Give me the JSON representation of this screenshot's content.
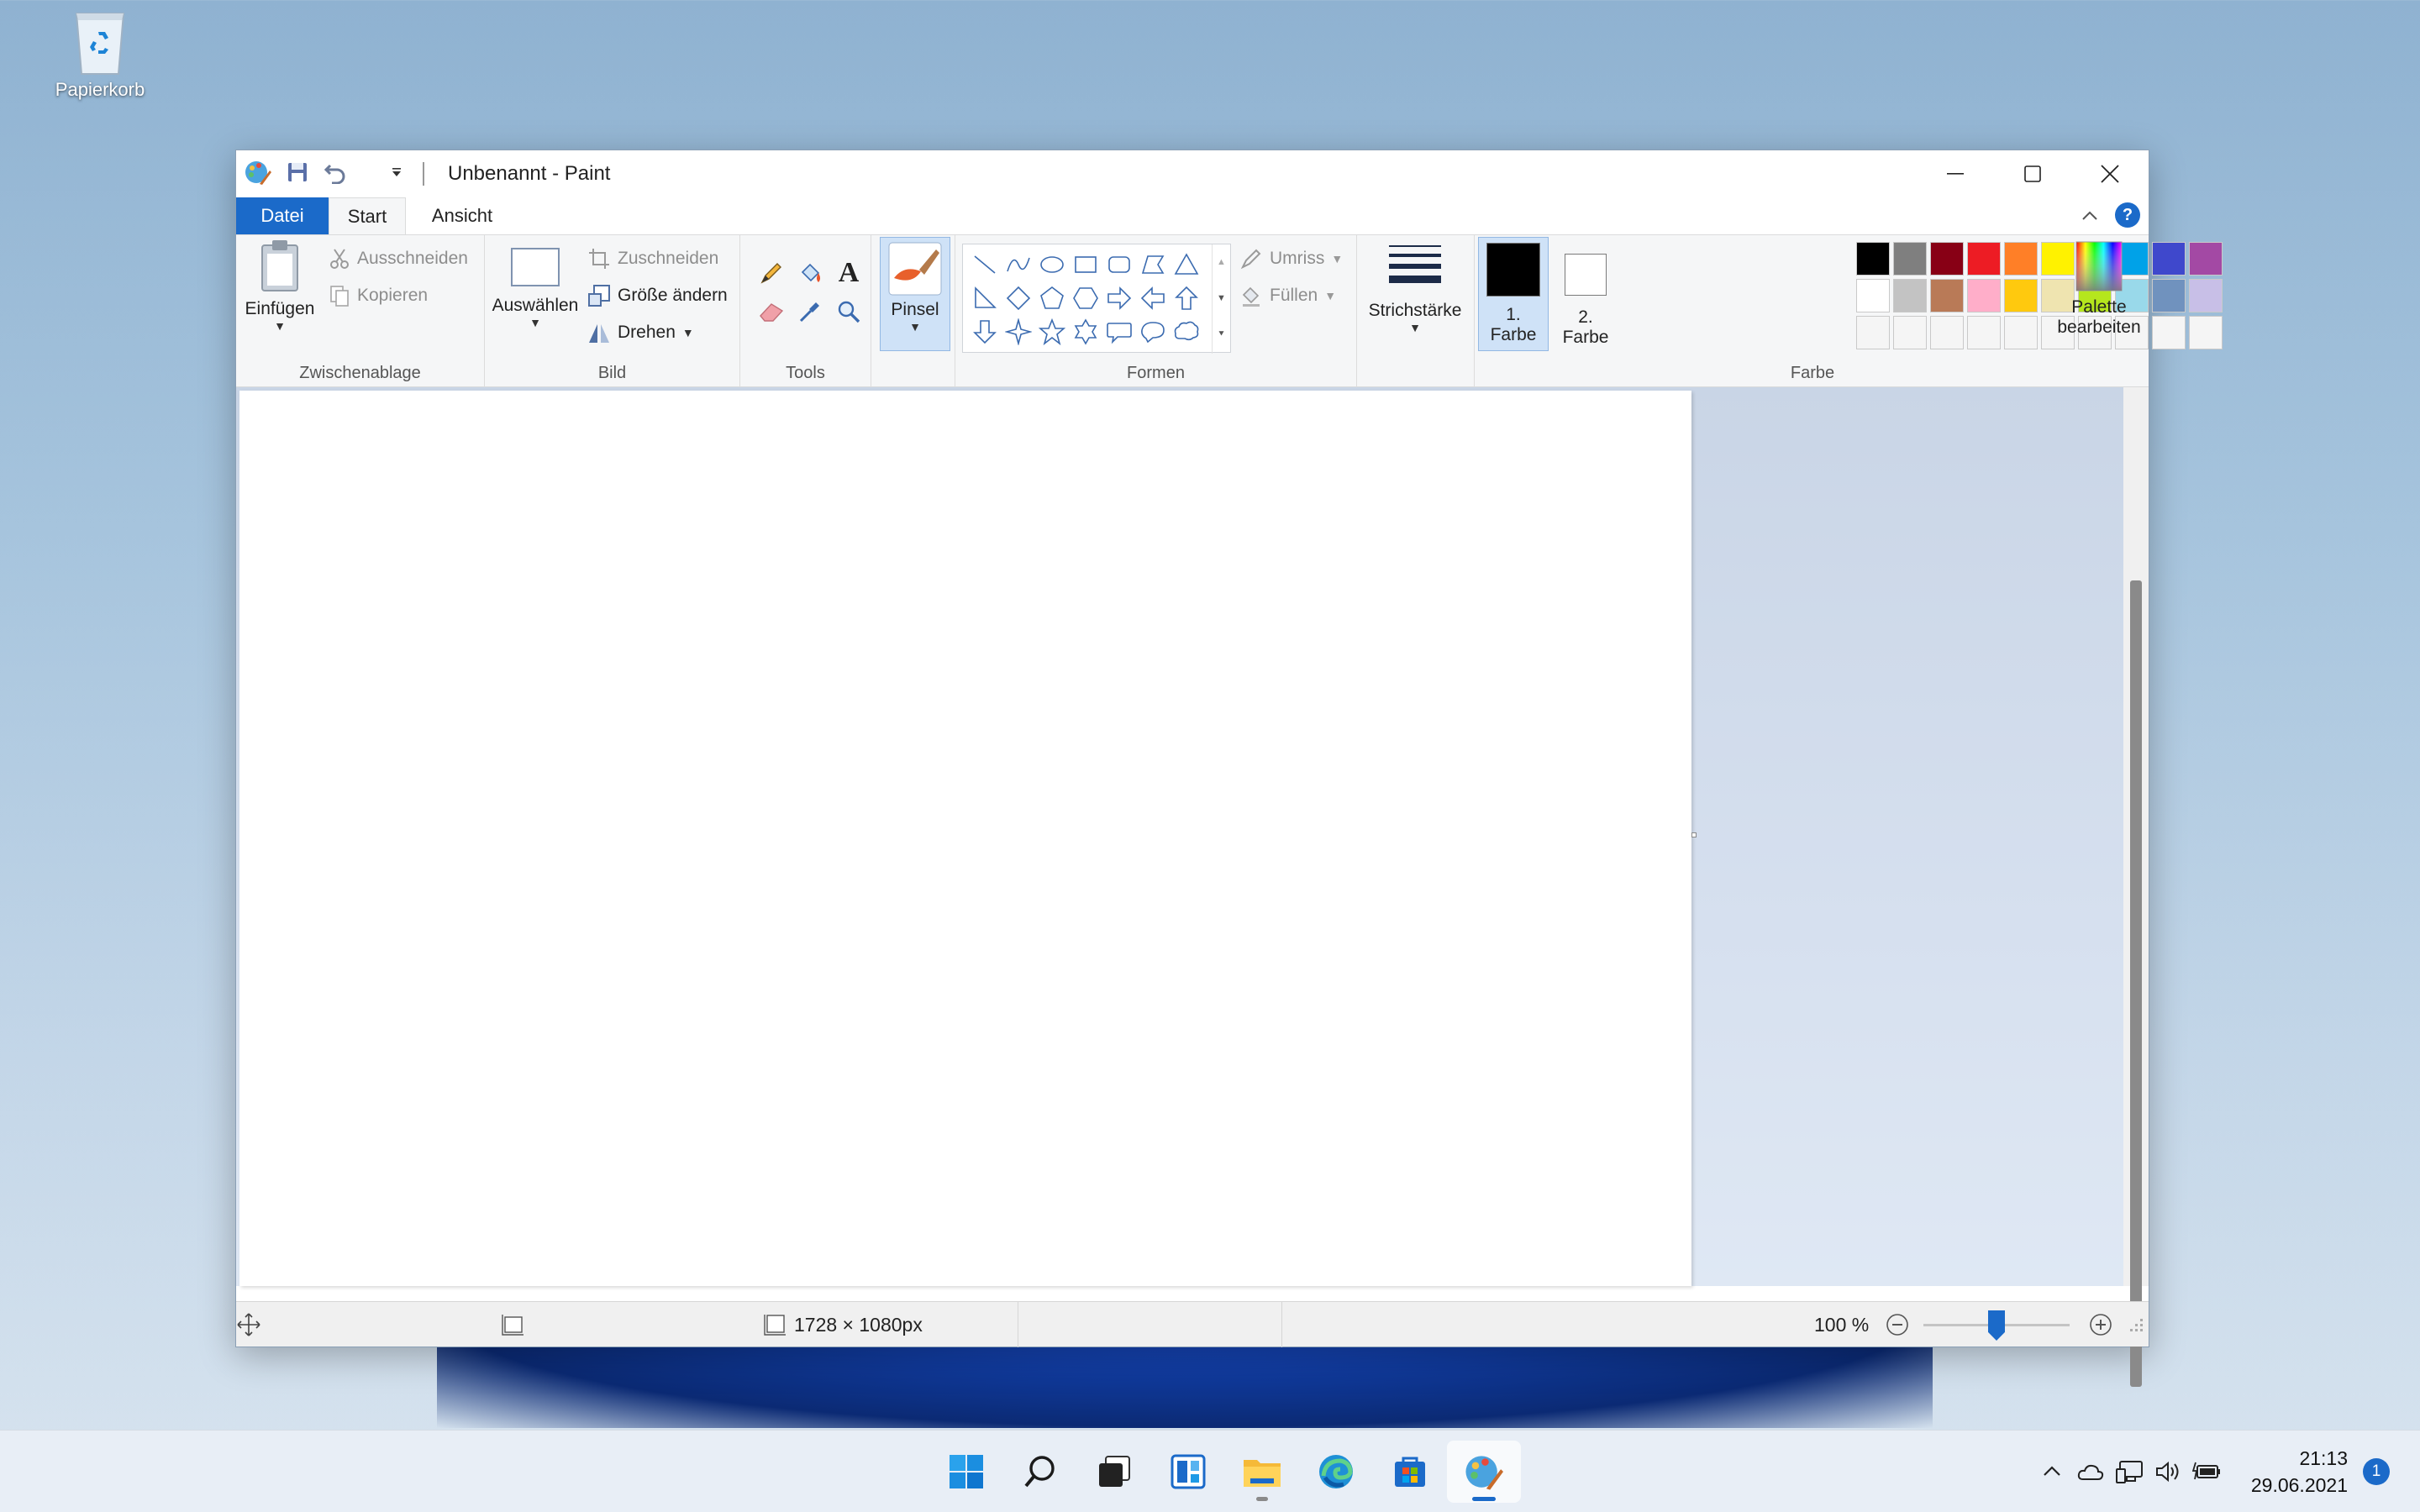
{
  "desktop": {
    "recycle_bin_label": "Papierkorb"
  },
  "window": {
    "title": "Unbenannt - Paint",
    "controls": {
      "minimize": "minimize",
      "maximize": "maximize",
      "close": "close"
    }
  },
  "tabs": {
    "file": "Datei",
    "home": "Start",
    "view": "Ansicht",
    "help": "?"
  },
  "ribbon": {
    "clipboard": {
      "group_label": "Zwischenablage",
      "paste": "Einfügen",
      "cut": "Ausschneiden",
      "copy": "Kopieren"
    },
    "image": {
      "group_label": "Bild",
      "select": "Auswählen",
      "crop": "Zuschneiden",
      "resize": "Größe ändern",
      "rotate": "Drehen"
    },
    "tools": {
      "group_label": "Tools",
      "items": [
        "pencil",
        "fill",
        "text",
        "eraser",
        "color-picker",
        "magnifier"
      ]
    },
    "brushes": {
      "label": "Pinsel"
    },
    "shapes": {
      "group_label": "Formen",
      "outline": "Umriss",
      "fill": "Füllen",
      "items": [
        "line",
        "curve",
        "oval",
        "rectangle",
        "rounded-rectangle",
        "polygon",
        "triangle",
        "right-triangle",
        "diamond",
        "pentagon",
        "hexagon",
        "right-arrow",
        "left-arrow",
        "up-arrow",
        "down-arrow",
        "four-point-star",
        "five-point-star",
        "six-point-star",
        "rounded-callout",
        "oval-callout",
        "cloud-callout"
      ]
    },
    "size": {
      "label": "Strichstärke"
    },
    "colors": {
      "group_label": "Farbe",
      "color1_line1": "1.",
      "color1_line2": "Farbe",
      "color2_line1": "2.",
      "color2_line2": "Farbe",
      "color1_value": "#000000",
      "color2_value": "#ffffff",
      "edit_line1": "Palette",
      "edit_line2": "bearbeiten",
      "palette_row1": [
        "#000000",
        "#7f7f7f",
        "#880015",
        "#ed1c24",
        "#ff7f27",
        "#fff200",
        "#22b14c",
        "#00a2e8",
        "#3f48cc",
        "#a349a4"
      ],
      "palette_row2": [
        "#ffffff",
        "#c3c3c3",
        "#b97a57",
        "#ffaec9",
        "#ffc90e",
        "#efe4b0",
        "#b5e61d",
        "#99d9ea",
        "#7092be",
        "#c8bfe7"
      ],
      "palette_row3": [
        "#f5f5f5",
        "#f5f5f5",
        "#f5f5f5",
        "#f5f5f5",
        "#f5f5f5",
        "#f5f5f5",
        "#f5f5f5",
        "#f5f5f5",
        "#f5f5f5",
        "#f5f5f5"
      ]
    }
  },
  "statusbar": {
    "canvas_size": "1728 × 1080px",
    "zoom": "100 %",
    "zoom_level_percent": 100
  },
  "taskbar": {
    "apps": [
      "start",
      "search",
      "task-view",
      "widgets",
      "file-explorer",
      "edge",
      "store",
      "paint"
    ],
    "active_app": "paint",
    "time": "21:13",
    "date": "29.06.2021",
    "notifications": "1"
  },
  "colors": {
    "accent": "#1b6ac9"
  }
}
